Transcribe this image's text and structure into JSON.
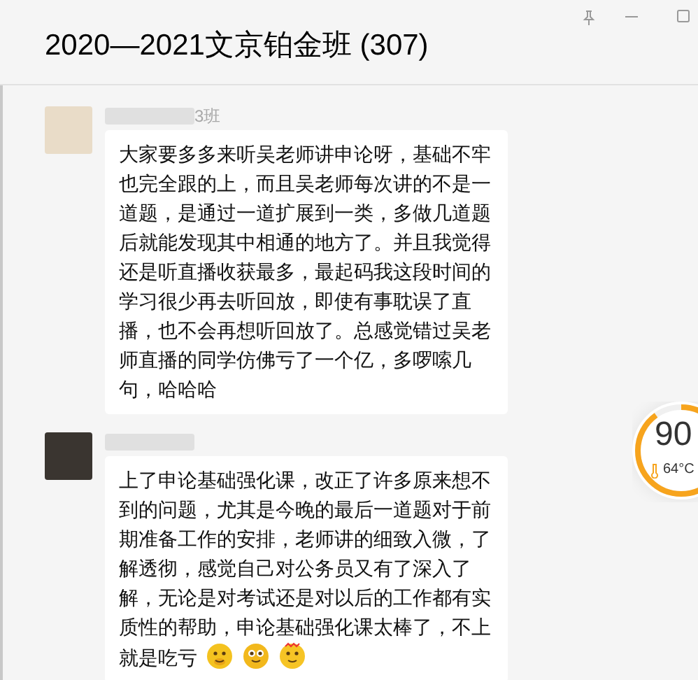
{
  "window": {
    "title": "2020—2021文京铂金班 (307)"
  },
  "messages": [
    {
      "sender": "3班",
      "text": "大家要多多来听吴老师讲申论呀，基础不牢也完全跟的上，而且吴老师每次讲的不是一道题，是通过一道扩展到一类，多做几道题后就能发现其中相通的地方了。并且我觉得还是听直播收获最多，最起码我这段时间的学习很少再去听回放，即使有事耽误了直播，也不会再想听回放了。总感觉错过吴老师直播的同学仿佛亏了一个亿，多啰嗦几句，哈哈哈"
    },
    {
      "text": "上了申论基础强化课，改正了许多原来想不到的问题，尤其是今晚的最后一道题对于前期准备工作的安排，老师讲的细致入微，了解透彻，感觉自己对公务员又有了深入了解，无论是对考试还是对以后的工作都有实质性的帮助，申论基础强化课太棒了，不上就是吃亏",
      "stickers": [
        {
          "kind": "shush"
        },
        {
          "kind": "flushed"
        },
        {
          "kind": "fire"
        }
      ]
    }
  ],
  "widget": {
    "value": "90",
    "temperature": "64°C",
    "level": 0.9
  }
}
